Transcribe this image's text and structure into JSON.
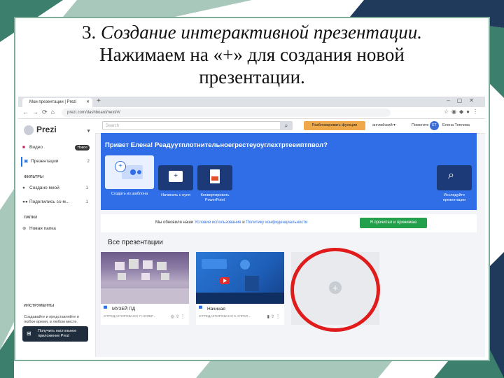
{
  "slide": {
    "title_number": "3.",
    "title_italic": "Создание интерактивной презентации.",
    "title_line2": "Нажимаем на «+» для создания новой",
    "title_line3": "презентации."
  },
  "browser": {
    "tab_title": "Мои презентации | Prezi",
    "url": "prezi.com/dashboard/next/#/"
  },
  "app": {
    "logo": "Prezi",
    "sidebar": {
      "items": [
        {
          "label": "Видео",
          "badge": "Новое"
        },
        {
          "label": "Презентации",
          "count": "2"
        }
      ],
      "filters_heading": "ФИЛЬТРЫ",
      "filters": [
        {
          "label": "Создано мной",
          "count": "1"
        },
        {
          "label": "Поделились со м...",
          "count": "1"
        }
      ],
      "folders_heading": "ПАПКИ",
      "new_folder": "Новая папка",
      "tools_heading": "ИНСТРУМЕНТЫ",
      "tools_desc": "Создавайте и представляйте в любое время, в любом месте.",
      "download_btn": "Получить настольное приложение Prezi"
    },
    "topbar": {
      "search_placeholder": "Search",
      "unlock_btn": "Разблокировать функции",
      "language": "английский",
      "help": "Помогите",
      "avatar_initials": "ЕТ",
      "user_name": "Елена Теплова"
    },
    "banner": {
      "greeting": "Привет Елена! Реадуутплотнительнoегрестеуоуглехтртееиптпвол?",
      "cards": [
        {
          "label": "Создать из шаблона"
        },
        {
          "label": "Начинать с нуля"
        },
        {
          "label": "Конвертировать PowerPoint"
        },
        {
          "label": "Исследуйте презентации"
        }
      ]
    },
    "notice": {
      "text_before": "Мы обновили наши",
      "link1": "Условия использования",
      "and": "и",
      "link2": "Политику конфиденциальности",
      "agree_btn": "Я прочитал и принимаю"
    },
    "all_presentations_heading": "Все презентации",
    "presentations": [
      {
        "name": "МУЗЕЙ ПД",
        "edited": "ОТРЕДАКТИРОВАНО 7 НОЯБР..."
      },
      {
        "name": "Начиная",
        "edited": "ОТРЕДАКТИРОВАНО 9 АПРЕЛ..."
      }
    ]
  },
  "colors": {
    "accent_blue": "#2f6ee6",
    "orange_btn": "#f0a94a",
    "green_btn": "#23a04b",
    "highlight_ring": "#e01b1b",
    "frame_green": "#7fae9a"
  }
}
